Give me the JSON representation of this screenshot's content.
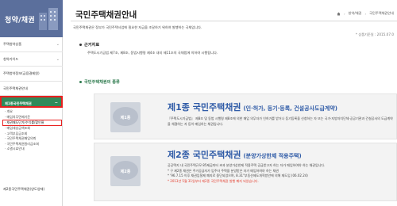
{
  "sidebar": {
    "title": "청약/채권",
    "items": [
      {
        "label": "주택청약상품"
      },
      {
        "label": "청약가이드"
      },
      {
        "label": "주택청약정보(금융결제원)"
      },
      {
        "label": "국민주택채권안내"
      },
      {
        "label": "제1종국민주택채권",
        "active": true
      }
    ],
    "sub_items": [
      {
        "label": "· 개요"
      },
      {
        "label": "· 매입의무면제기준"
      },
      {
        "label": "· 채권매도단가/수익률/할인율",
        "highlight": true
      },
      {
        "label": "· 매입대상금액조회"
      },
      {
        "label": "· 고객부담금조회"
      },
      {
        "label": "· 국민주택채권매입의뢰"
      },
      {
        "label": "· 국민주택채권원리금조회"
      },
      {
        "label": "· 소멸시효안내"
      }
    ],
    "bottom": "제2종국민주택채권(양도양재)"
  },
  "main": {
    "title": "국민주택채권안내",
    "breadcrumb": [
      "창약/채권",
      "국민주택채권안내"
    ],
    "intro": "국민주택채권은 정부가 국민주택사업에 필요한 자금을 조달하기 위하여 발행하는 국채입니다.",
    "date_note": "* 상품기준일 : 2015.07.0",
    "legal_head": "근거자료",
    "legal_text": "주택도시기금법 제7조, 제8조, 동법시행령 제4조 내지 제11조의 국채법에 의하여 시행됩니다.",
    "bond_head": "국민주택채권의 종류",
    "cards": [
      {
        "badge": "제1종",
        "title": "제1종 국민주택채권",
        "subtitle": "(인·허가, 등기·등록, 건설공사도급계약)",
        "desc": "『주택도시기금법』 제8조 및 동법 시행령 제8조에 의한 매입 의무자가 인허가를 받거나 등기등록을 신청하는 자 또는 국가·지방자치단체·공공기관과 건설공사의 도급계약을 체결하는 자 등이 매입하는 채권입니다.",
        "notes": []
      },
      {
        "badge": "제2종",
        "title": "제2종 국민주택채권",
        "subtitle": "(분양가상한제 적용주택)",
        "desc": "공공택지 내 국민주택규모 85제곱미터 초과 분양가상한제 적용주택 공급받고자 하는 자가 매입하여야 하는 채권입니다.",
        "notes": [
          "* 구 제2종 채권은 주거공급자가 입주자 주택을 분양받은 자가 매입하여야 하는 채권",
          "* '96.7.15 이후 채권입찰제 폐지로 중단되었으며, 8.31\"부동산제도개혁방안에 의해 재도입 (06.02.24)",
          "* 2013년 5월 31일부터 제2종 국민주택채권 발행 폐지 되었습니다."
        ]
      }
    ]
  }
}
